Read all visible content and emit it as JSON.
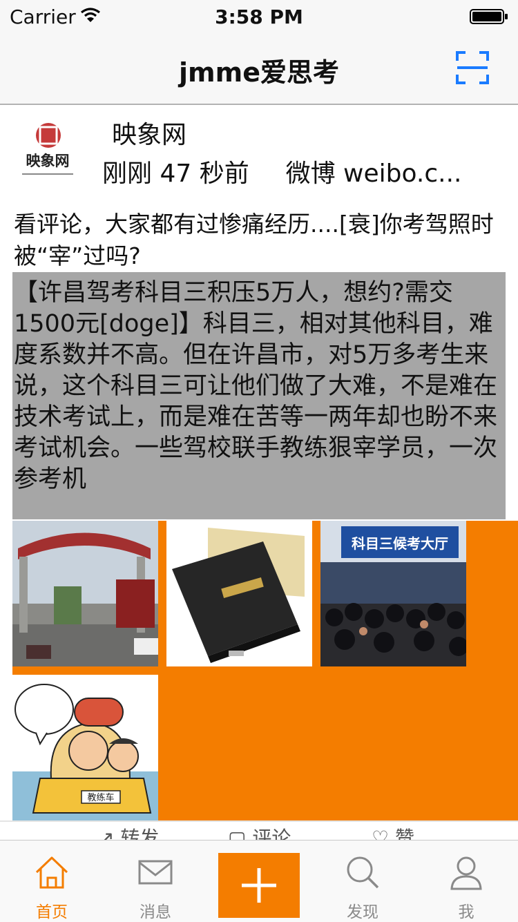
{
  "status_bar": {
    "carrier": "Carrier",
    "time": "3:58 PM"
  },
  "nav": {
    "title": "jmme爱思考",
    "scan_icon": "scan-icon"
  },
  "post": {
    "author": "映象网",
    "avatar_text": "映象网",
    "time": "刚刚 47 秒前",
    "source": "微博 weibo.c...",
    "text": "看评论，大家都有过惨痛经历....[衰]你考驾照时被“宰”过吗?",
    "quote": "【许昌驾考科目三积压5万人，想约?需交1500元[doge]】科目三，相对其他科目，难度系数并不高。但在许昌市，对5万多考生来说，这个科目三可让他们做了大难，不是难在技术考试上，而是难在苦等一两年却也盼不来考试机会。一些驾校联手教练狠宰学员，一次参考机",
    "images": [
      {
        "name": "photo-gate"
      },
      {
        "name": "photo-license-book"
      },
      {
        "name": "photo-exam-hall",
        "sign": "科目三候考大厅"
      },
      {
        "name": "photo-cartoon",
        "sign": "教练车"
      }
    ],
    "actions": [
      {
        "label": "转发",
        "icon": "repost-icon"
      },
      {
        "label": "评论",
        "icon": "comment-icon"
      },
      {
        "label": "赞",
        "icon": "like-icon"
      }
    ]
  },
  "tabs": [
    {
      "label": "首页",
      "icon": "home-icon",
      "active": true
    },
    {
      "label": "消息",
      "icon": "mail-icon"
    },
    {
      "label": "",
      "icon": "plus-icon"
    },
    {
      "label": "发现",
      "icon": "search-icon"
    },
    {
      "label": "我",
      "icon": "profile-icon"
    }
  ],
  "colors": {
    "accent": "#f47d00",
    "quote_bg": "#a6a6a6",
    "tint": "#1a7bff"
  }
}
